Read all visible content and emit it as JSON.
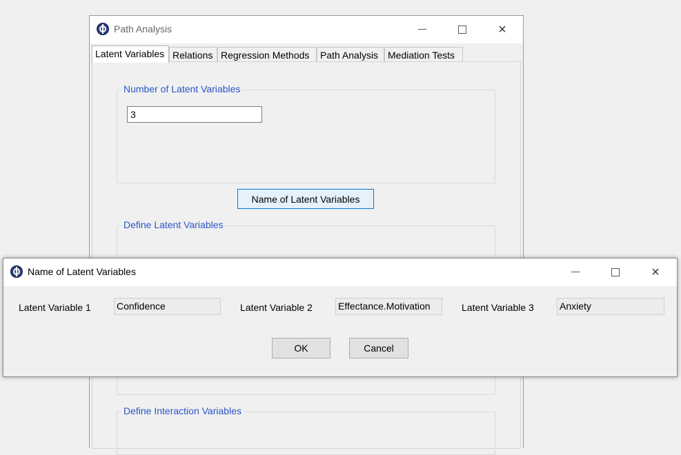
{
  "main_window": {
    "title": "Path Analysis",
    "tabs": [
      {
        "label": "Latent Variables",
        "active": true
      },
      {
        "label": "Relations"
      },
      {
        "label": "Regression Methods"
      },
      {
        "label": "Path Analysis"
      },
      {
        "label": "Mediation Tests"
      }
    ],
    "number_group": {
      "label": "Number of Latent Variables",
      "value": "3"
    },
    "name_button_label": "Name of Latent Variables",
    "define_group_label": "Define Latent Variables",
    "interaction_group_label": "Define Interaction Variables"
  },
  "dialog": {
    "title": "Name of Latent Variables",
    "fields": [
      {
        "label": "Latent Variable 1",
        "value": "Confidence"
      },
      {
        "label": "Latent Variable 2",
        "value": "Effectance.Motivation"
      },
      {
        "label": "Latent Variable 3",
        "value": "Anxiety"
      }
    ],
    "ok_label": "OK",
    "cancel_label": "Cancel"
  },
  "colors": {
    "group_label": "#2a55c8",
    "focus_border": "#0078d7"
  },
  "icons": {
    "app": "globe-network-icon",
    "minimize": "minimize-icon",
    "maximize": "maximize-icon",
    "close": "close-icon"
  }
}
